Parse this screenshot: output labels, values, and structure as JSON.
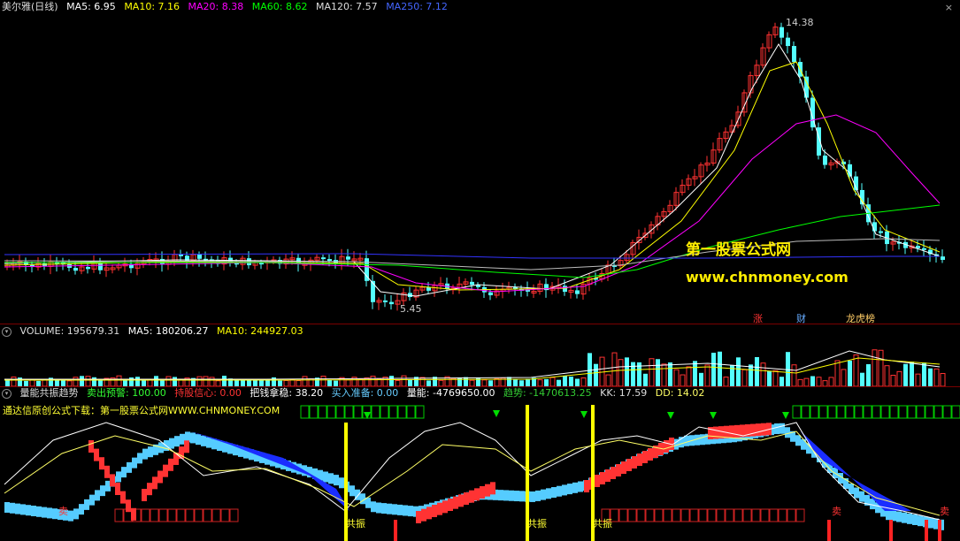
{
  "main_header": {
    "title": "美尔雅(日线)",
    "ma5": "MA5: 6.95",
    "ma10": "MA10: 7.16",
    "ma20": "MA20: 8.38",
    "ma60": "MA60: 8.62",
    "ma120": "MA120: 7.57",
    "ma250": "MA250: 7.12",
    "close": "×"
  },
  "price_labels": {
    "high": "14.38",
    "low": "5.45"
  },
  "watermark": {
    "line1": "第一股票公式网",
    "line2": "www.chnmoney.com"
  },
  "event_tags": [
    {
      "text": "涨",
      "color": "#ff3333"
    },
    {
      "text": "财",
      "color": "#66aaff"
    },
    {
      "text": "龙虎榜",
      "color": "#ffcc66"
    }
  ],
  "volume_header": {
    "volume": "VOLUME: 195679.31",
    "ma5": "MA5: 180206.27",
    "ma10": "MA10: 244927.03"
  },
  "indicator_header": {
    "name": "量能共振趋势",
    "sell_warn": "卖出预警: 100.00",
    "hold": "持股信心: 0.00",
    "steady": "把钱拿稳: 38.20",
    "buy_ready": "买入准备: 0.00",
    "energy": "量能: -4769650.00",
    "trend": "趋势: -1470613.25",
    "kk": "KK: 17.59",
    "dd": "DD: 14.02"
  },
  "indicator_banner": {
    "prefix": "通达信原创公式下载：",
    "site": "第一股票公式网WWW.CHNMONEY.COM"
  },
  "resonance_labels": [
    "共振",
    "共振",
    "共振"
  ],
  "sell_labels": [
    "卖",
    "卖",
    "卖"
  ],
  "colors": {
    "up": "#ff3232",
    "down": "#54ffff",
    "ma5": "#ffffff",
    "ma10": "#ffff00",
    "ma20": "#ff00ff",
    "ma60": "#00ff00",
    "ma120": "#bbbbbb",
    "ma250": "#3333ff"
  }
}
